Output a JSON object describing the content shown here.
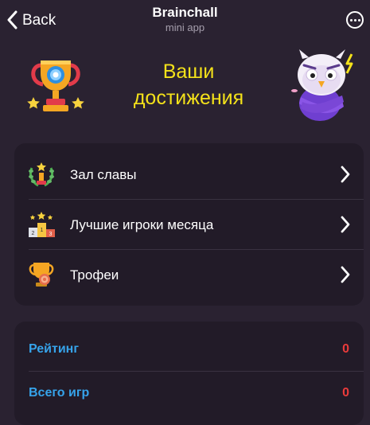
{
  "header": {
    "back_label": "Back",
    "title": "Brainchall",
    "subtitle": "mini app"
  },
  "hero": {
    "title_line1": "Ваши",
    "title_line2": "достижения"
  },
  "menu": {
    "items": [
      {
        "label": "Зал славы",
        "icon": "laurel-trophy-icon"
      },
      {
        "label": "Лучшие игроки месяца",
        "icon": "podium-icon"
      },
      {
        "label": "Трофеи",
        "icon": "trophy-medal-icon"
      }
    ]
  },
  "stats": {
    "rows": [
      {
        "label": "Рейтинг",
        "value": "0"
      },
      {
        "label": "Всего игр",
        "value": "0"
      }
    ]
  },
  "colors": {
    "background": "#2a2231",
    "card": "#221b28",
    "accent_yellow": "#f4e21a",
    "stat_label_blue": "#36a3ea",
    "stat_value_red": "#ea3b3b"
  },
  "podium_digits": [
    "2",
    "1",
    "3"
  ]
}
